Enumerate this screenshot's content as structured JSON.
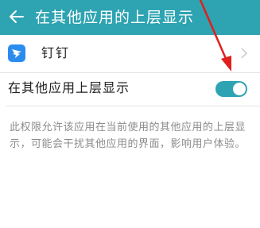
{
  "header": {
    "title": "在其他应用的上层显示",
    "color": "#2ea3b1"
  },
  "app": {
    "name": "钉钉",
    "icon": "dingtalk-icon",
    "icon_color": "#2b8cf0"
  },
  "setting": {
    "label": "在其他应用上层显示",
    "enabled": true,
    "switch_color": "#2ea3b1"
  },
  "description": "此权限允许该应用在当前使用的其他应用的上层显示，可能会干扰其他应用的界面，影响用户体验。",
  "annotation": {
    "arrow_color": "#e0201c"
  }
}
